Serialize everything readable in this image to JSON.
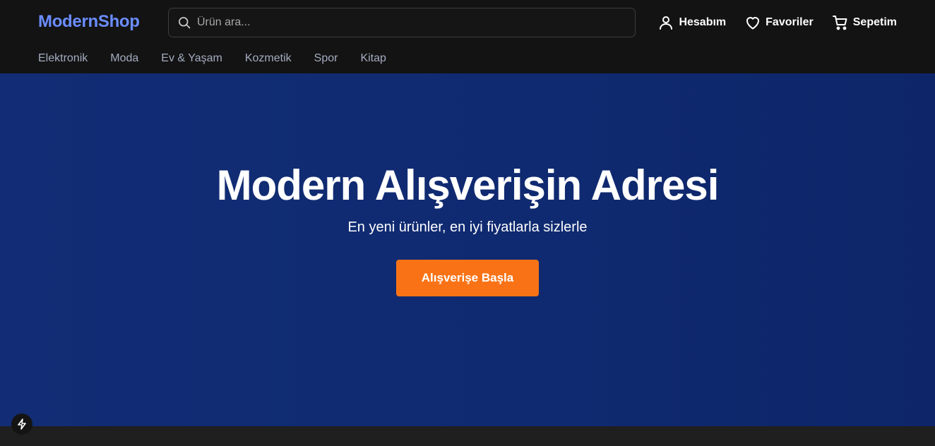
{
  "header": {
    "logo": "ModernShop",
    "search_placeholder": "Ürün ara...",
    "actions": {
      "account": "Hesabım",
      "favorites": "Favoriler",
      "cart": "Sepetim"
    }
  },
  "categories": [
    "Elektronik",
    "Moda",
    "Ev & Yaşam",
    "Kozmetik",
    "Spor",
    "Kitap"
  ],
  "hero": {
    "title": "Modern Alışverişin Adresi",
    "subtitle": "En yeni ürünler, en iyi fiyatlarla sizlerle",
    "cta": "Alışverişe Başla"
  },
  "colors": {
    "logo": "#6b8dff",
    "hero_background": "#112c73",
    "cta": "#f97316",
    "header_background": "#131313"
  },
  "icons": {
    "search": "search-icon",
    "account": "user-icon",
    "favorites": "heart-icon",
    "cart": "cart-icon",
    "dev": "lightning-icon"
  }
}
